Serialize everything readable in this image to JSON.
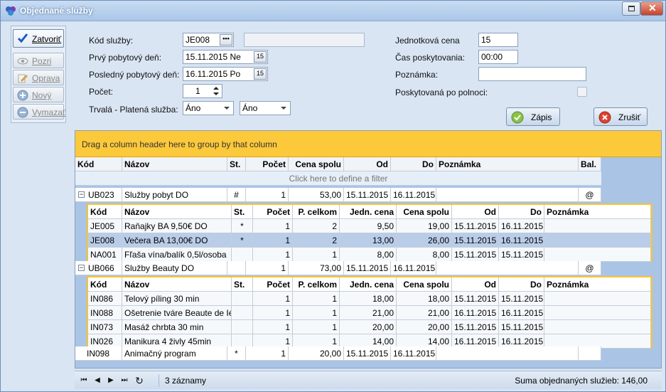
{
  "window": {
    "title": "Objednané služby",
    "title_icon": "app-icon",
    "restore_icon": "restore-icon",
    "close_icon": "close-icon"
  },
  "toolbar": [
    {
      "label": "Zatvoriť",
      "icon": "checkmark-icon",
      "active": true
    },
    {
      "label": "Pozri",
      "icon": "eye-icon",
      "active": false
    },
    {
      "label": "Oprava",
      "icon": "pencil-icon",
      "active": false
    },
    {
      "label": "Nový",
      "icon": "plus-icon",
      "active": false
    },
    {
      "label": "Vymazať",
      "icon": "minus-icon",
      "active": false
    }
  ],
  "form": {
    "kod_sluzby_label": "Kód služby:",
    "kod_sluzby_value": "JE008",
    "kod_sluzby_button": "•••",
    "kod_sluzby_desc": "",
    "prvy_den_label": "Prvý pobytový deň:",
    "prvy_den_value": "15.11.2015  Ne",
    "posledny_den_label": "Posledný pobytový deň:",
    "posledny_den_value": "16.11.2015  Po",
    "pocet_label": "Počet:",
    "pocet_value": "1",
    "trvala_label": "Trvalá - Platená služba:",
    "trvala_value": "Áno",
    "platena_value": "Áno",
    "jednotkova_cena_label": "Jednotková cena",
    "jednotkova_cena_value": "15",
    "cas_label": "Čas poskytovania:",
    "cas_value": "00:00",
    "poznamka_label": "Poznámka:",
    "poznamka_value": "",
    "polnoc_label": "Poskytovaná po polnoci:",
    "zapis_label": "Zápis",
    "zrusit_label": "Zrušiť"
  },
  "grid": {
    "group_hint": "Drag a column header here to group by that column",
    "filter_hint": "Click here to define a filter",
    "columns": [
      "Kód",
      "Názov",
      "St.",
      "Počet",
      "Cena spolu",
      "Od",
      "Do",
      "Poznámka",
      "Bal."
    ],
    "detail_columns": [
      "Kód",
      "Názov",
      "St.",
      "Počet",
      "P. celkom",
      "Jedn. cena",
      "Cena spolu",
      "Od",
      "Do",
      "Poznámka"
    ],
    "groups": [
      {
        "expander": "−",
        "kod": "UB023",
        "nazov": "Služby pobyt DO",
        "st": "#",
        "pocet": "1",
        "cena": "53,00",
        "od": "15.11.2015",
        "do": "16.11.2015",
        "poznamka": "",
        "bal": "@",
        "items": [
          {
            "kod": "JE005",
            "nazov": "Raňajky BA 9,50€ DO",
            "st": "*",
            "pocet": "1",
            "pcelkom": "2",
            "jedn": "9,50",
            "cena": "19,00",
            "od": "15.11.2015",
            "do": "16.11.2015",
            "poznamka": "",
            "selected": false
          },
          {
            "kod": "JE008",
            "nazov": "Večera BA 13,00€ DO",
            "st": "*",
            "pocet": "1",
            "pcelkom": "2",
            "jedn": "13,00",
            "cena": "26,00",
            "od": "15.11.2015",
            "do": "16.11.2015",
            "poznamka": "",
            "selected": true
          },
          {
            "kod": "NA001",
            "nazov": "Fľaša vína/balík 0,5l/osoba",
            "st": "",
            "pocet": "1",
            "pcelkom": "1",
            "jedn": "8,00",
            "cena": "8,00",
            "od": "15.11.2015",
            "do": "15.11.2015",
            "poznamka": "",
            "selected": false
          }
        ]
      },
      {
        "expander": "−",
        "kod": "UB066",
        "nazov": "Služby Beauty DO",
        "st": "",
        "pocet": "1",
        "cena": "73,00",
        "od": "15.11.2015",
        "do": "16.11.2015",
        "poznamka": "",
        "bal": "@",
        "items": [
          {
            "kod": "IN086",
            "nazov": "Telový píling 30 min",
            "st": "",
            "pocet": "1",
            "pcelkom": "1",
            "jedn": "18,00",
            "cena": "18,00",
            "od": "15.11.2015",
            "do": "15.11.2015",
            "poznamka": "",
            "selected": false
          },
          {
            "kod": "IN088",
            "nazov": "Ošetrenie tváre Beaute de Ié",
            "st": "",
            "pocet": "1",
            "pcelkom": "1",
            "jedn": "21,00",
            "cena": "21,00",
            "od": "16.11.2015",
            "do": "16.11.2015",
            "poznamka": "",
            "selected": false
          },
          {
            "kod": "IN073",
            "nazov": "Masáž chrbta 30 min",
            "st": "",
            "pocet": "1",
            "pcelkom": "1",
            "jedn": "20,00",
            "cena": "20,00",
            "od": "15.11.2015",
            "do": "15.11.2015",
            "poznamka": "",
            "selected": false
          },
          {
            "kod": "IN026",
            "nazov": "Manikura 4 živly 45min",
            "st": "",
            "pocet": "1",
            "pcelkom": "1",
            "jedn": "14,00",
            "cena": "14,00",
            "od": "16.11.2015",
            "do": "16.11.2015",
            "poznamka": "",
            "selected": false
          }
        ]
      }
    ],
    "single": {
      "kod": "IN098",
      "nazov": "Animačný program",
      "st": "*",
      "pocet": "1",
      "cena": "20,00",
      "od": "15.11.2015",
      "do": "16.11.2015",
      "poznamka": "",
      "bal": ""
    }
  },
  "status": {
    "nav": [
      "⏮",
      "◀",
      "▶",
      "⏭",
      "↻"
    ],
    "count": "3 záznamy",
    "sum": "Suma objednaných služieb: 146,00"
  }
}
